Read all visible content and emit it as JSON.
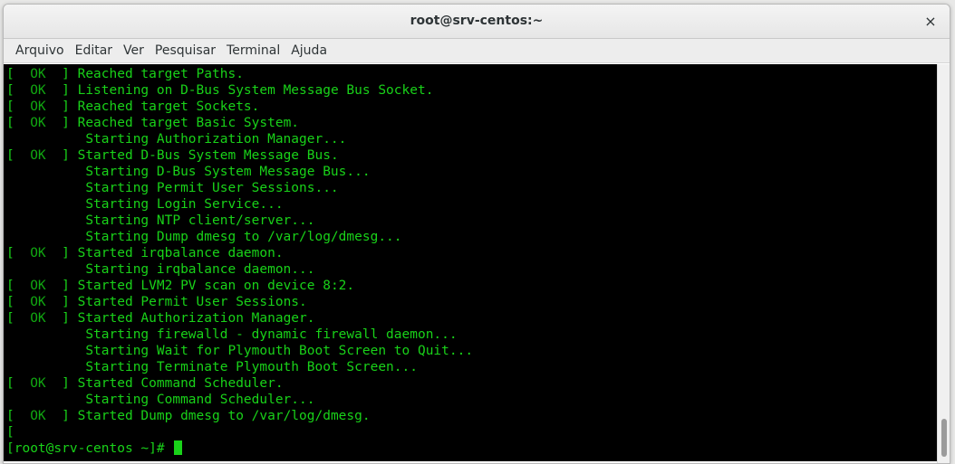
{
  "window": {
    "title": "root@srv-centos:~",
    "close_glyph": "×"
  },
  "menu": [
    "Arquivo",
    "Editar",
    "Ver",
    "Pesquisar",
    "Terminal",
    "Ajuda"
  ],
  "terminal": {
    "lines": [
      {
        "status": "OK",
        "text": "Reached target Paths."
      },
      {
        "status": "OK",
        "text": "Listening on D-Bus System Message Bus Socket."
      },
      {
        "status": "OK",
        "text": "Reached target Sockets."
      },
      {
        "status": "OK",
        "text": "Reached target Basic System."
      },
      {
        "status": "",
        "text": "Starting Authorization Manager..."
      },
      {
        "status": "OK",
        "text": "Started D-Bus System Message Bus."
      },
      {
        "status": "",
        "text": "Starting D-Bus System Message Bus..."
      },
      {
        "status": "",
        "text": "Starting Permit User Sessions..."
      },
      {
        "status": "",
        "text": "Starting Login Service..."
      },
      {
        "status": "",
        "text": "Starting NTP client/server..."
      },
      {
        "status": "",
        "text": "Starting Dump dmesg to /var/log/dmesg..."
      },
      {
        "status": "OK",
        "text": "Started irqbalance daemon."
      },
      {
        "status": "",
        "text": "Starting irqbalance daemon..."
      },
      {
        "status": "OK",
        "text": "Started LVM2 PV scan on device 8:2."
      },
      {
        "status": "OK",
        "text": "Started Permit User Sessions."
      },
      {
        "status": "OK",
        "text": "Started Authorization Manager."
      },
      {
        "status": "",
        "text": "Starting firewalld - dynamic firewall daemon..."
      },
      {
        "status": "",
        "text": "Starting Wait for Plymouth Boot Screen to Quit..."
      },
      {
        "status": "",
        "text": "Starting Terminate Plymouth Boot Screen..."
      },
      {
        "status": "OK",
        "text": "Started Command Scheduler."
      },
      {
        "status": "",
        "text": "Starting Command Scheduler..."
      },
      {
        "status": "OK",
        "text": "Started Dump dmesg to /var/log/dmesg."
      },
      {
        "status": "bracket",
        "text": "["
      }
    ],
    "prompt": "[root@srv-centos ~]# "
  },
  "colors": {
    "terminal_bg": "#000000",
    "terminal_fg": "#19d219",
    "ok": "#11a811"
  }
}
